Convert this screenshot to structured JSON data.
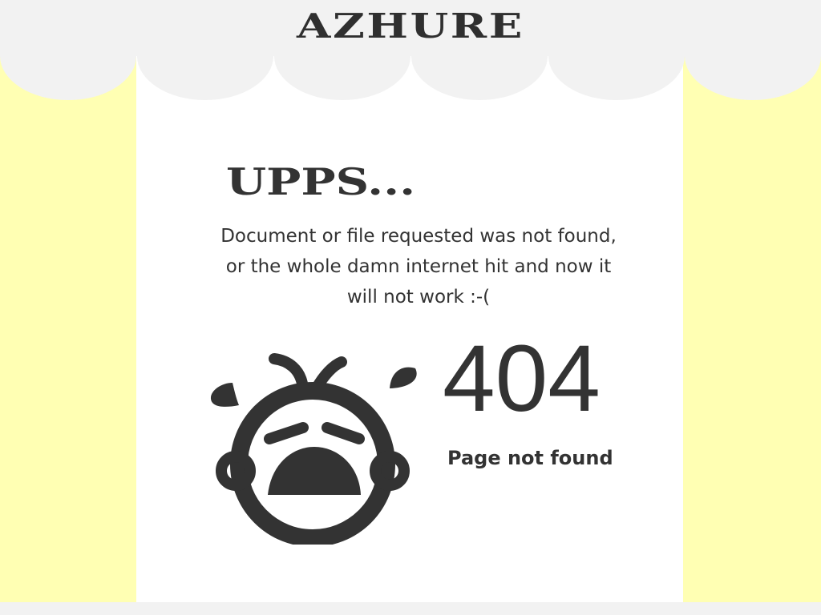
{
  "header": {
    "brand": "AZHURE"
  },
  "error_page": {
    "heading": "UPPS...",
    "message": "Document or file requested was not found, or the whole damn internet hit and now it will not work :-(",
    "code": "404",
    "subtitle": "Page not found",
    "illustration": "crying-baby-icon"
  },
  "colors": {
    "background": "#ffffb3",
    "panel": "#ffffff",
    "awning": "#f2f2f2",
    "text": "#333333"
  }
}
